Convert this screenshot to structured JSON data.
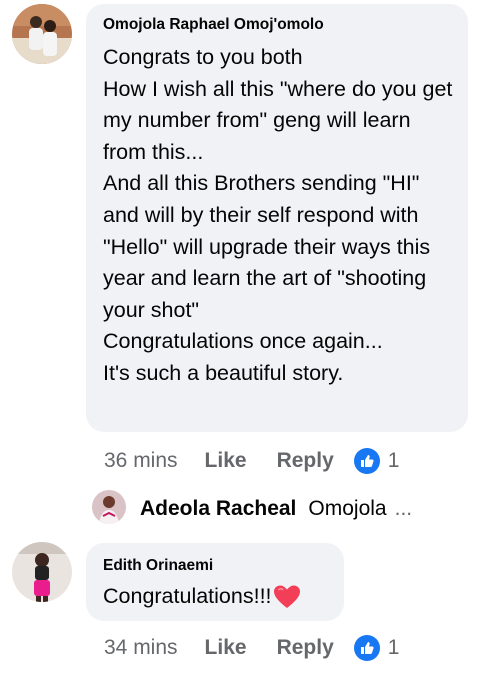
{
  "comments": [
    {
      "author": "Omojola Raphael Omoj'omolo",
      "text": "Congrats to you both\nHow I wish all this \"where do you get my number from\" geng will learn from this...\nAnd all this Brothers sending \"HI\" and will by their self respond with \"Hello\" will upgrade their ways this year and learn the art of \"shooting your shot\"\nCongratulations once again...\nIt's such a beautiful story.",
      "time": "36 mins",
      "like_label": "Like",
      "reply_label": "Reply",
      "reaction_count": "1",
      "reaction_icon": "thumbs-up-icon"
    },
    {
      "author": "Edith Orinaemi",
      "text": "Congratulations!!!",
      "emoji": "❤️",
      "time": "34 mins",
      "like_label": "Like",
      "reply_label": "Reply",
      "reaction_count": "1",
      "reaction_icon": "thumbs-up-icon"
    }
  ],
  "reply_preview": {
    "author": "Adeola Racheal",
    "preview": "Omojola",
    "ellipsis": "..."
  },
  "colors": {
    "bubble": "#f0f2f5",
    "meta": "#65676b",
    "like_badge": "#1877f2",
    "heart": "#f33e58"
  }
}
